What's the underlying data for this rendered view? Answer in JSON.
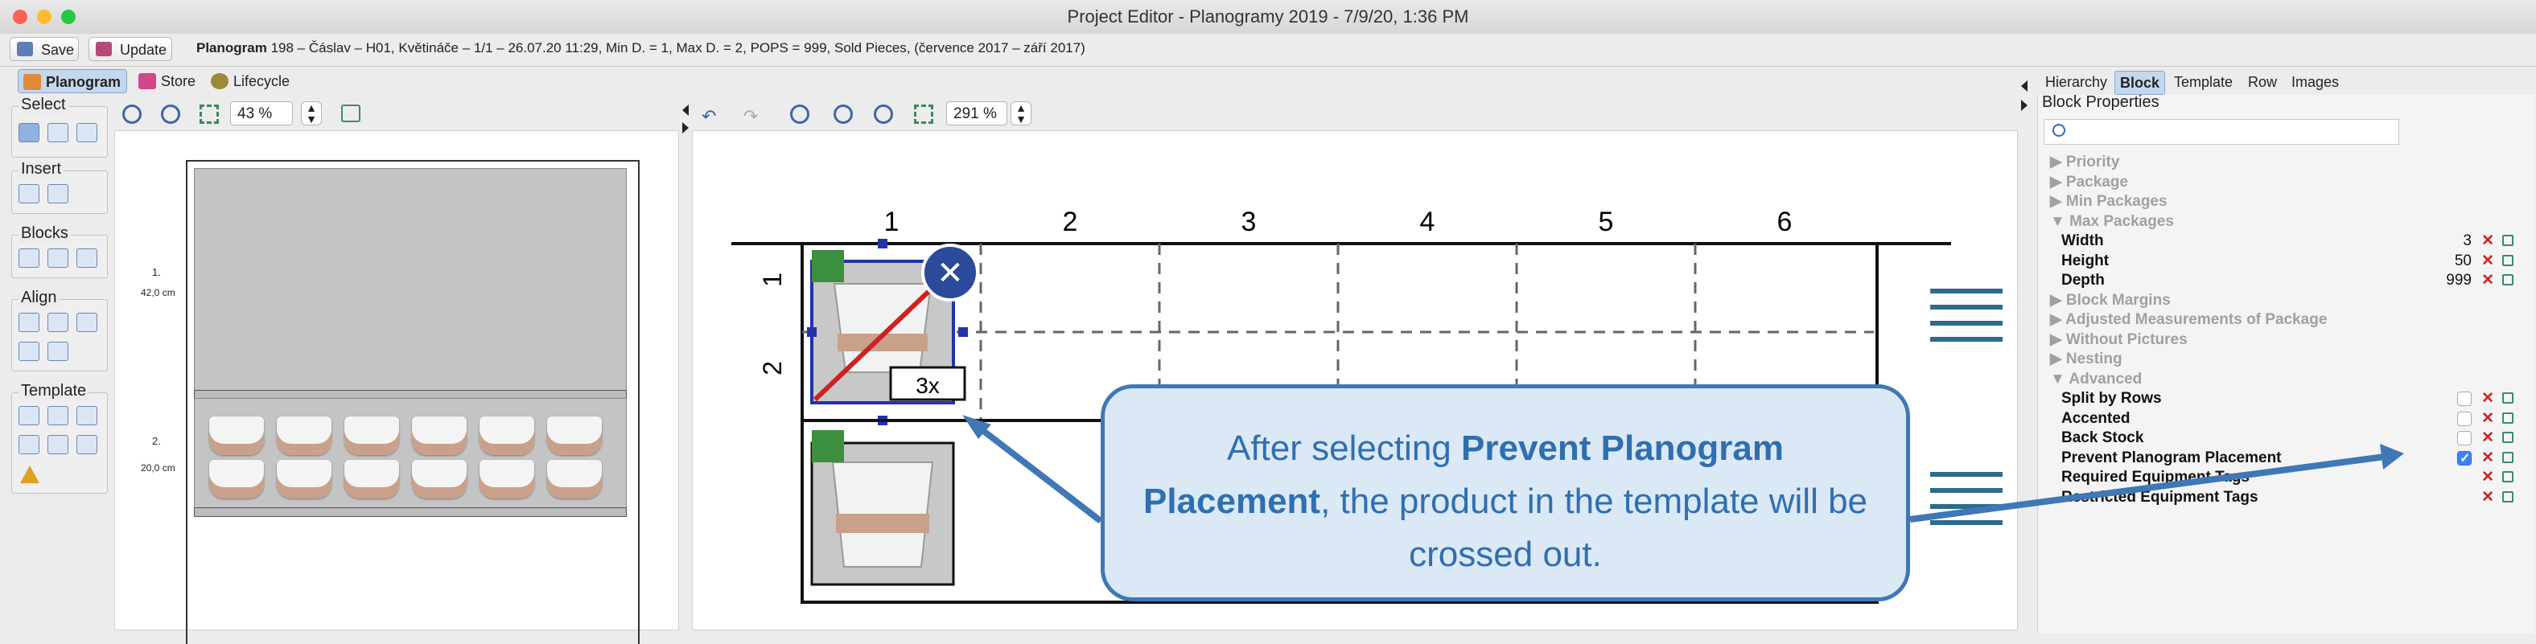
{
  "window": {
    "title": "Project Editor - Planogramy 2019 - 7/9/20, 1:36 PM"
  },
  "toolbar": {
    "save_label": "Save",
    "update_label": "Update",
    "planogram_label": "Planogram",
    "planogram_info": "198 – Čáslav – H01, Květináče – 1/1 – 26.07.20 11:29, Min D. = 1, Max D. = 2, POPS = 999, Sold Pieces, (července 2017 – září 2017)"
  },
  "view_tabs": [
    {
      "label": "Planogram",
      "active": true
    },
    {
      "label": "Store",
      "active": false
    },
    {
      "label": "Lifecycle",
      "active": false
    }
  ],
  "palette": {
    "select": "Select",
    "insert": "Insert",
    "blocks": "Blocks",
    "align": "Align",
    "template": "Template"
  },
  "left_view": {
    "zoom": "43 %",
    "shelves": [
      {
        "label": "1.",
        "size": "42,0 cm"
      },
      {
        "label": "2.",
        "size": "20,0 cm"
      }
    ]
  },
  "center_view": {
    "zoom": "291 %",
    "columns": [
      "1",
      "2",
      "3",
      "4",
      "5",
      "6"
    ],
    "rows": [
      "1",
      "2"
    ],
    "facing_label": "3x"
  },
  "right_tabs": [
    {
      "label": "Hierarchy",
      "active": false
    },
    {
      "label": "Block",
      "active": true
    },
    {
      "label": "Template",
      "active": false
    },
    {
      "label": "Row",
      "active": false
    },
    {
      "label": "Images",
      "active": false
    }
  ],
  "properties": {
    "title": "Block Properties",
    "search_placeholder": "",
    "sections": [
      {
        "label": "Priority",
        "expanded": false
      },
      {
        "label": "Package",
        "expanded": false
      },
      {
        "label": "Min Packages",
        "expanded": false
      },
      {
        "label": "Max Packages",
        "expanded": true
      }
    ],
    "max_packages": [
      {
        "label": "Width",
        "value": "3"
      },
      {
        "label": "Height",
        "value": "50"
      },
      {
        "label": "Depth",
        "value": "999"
      }
    ],
    "sections2": [
      {
        "label": "Block Margins"
      },
      {
        "label": "Adjusted Measurements of Package"
      },
      {
        "label": "Without Pictures"
      },
      {
        "label": "Nesting"
      },
      {
        "label": "Advanced"
      }
    ],
    "advanced": [
      {
        "label": "Split by Rows",
        "checked": false
      },
      {
        "label": "Accented",
        "checked": false
      },
      {
        "label": "Back Stock",
        "checked": false
      },
      {
        "label": "Prevent Planogram Placement",
        "checked": true
      },
      {
        "label": "Required Equipment Tags",
        "checked": null
      },
      {
        "label": "Restricted Equipment Tags",
        "checked": null
      }
    ]
  },
  "callout": {
    "prefix": "After selecting ",
    "bold": "Prevent Planogram Placement",
    "suffix": ", the product in the template will be crossed out."
  },
  "colors": {
    "accent": "#3f78b4",
    "callout_bg": "#dbe8f5",
    "selection": "#2233aa",
    "cross": "#cc2222",
    "green_marker": "#3c8f3c"
  }
}
